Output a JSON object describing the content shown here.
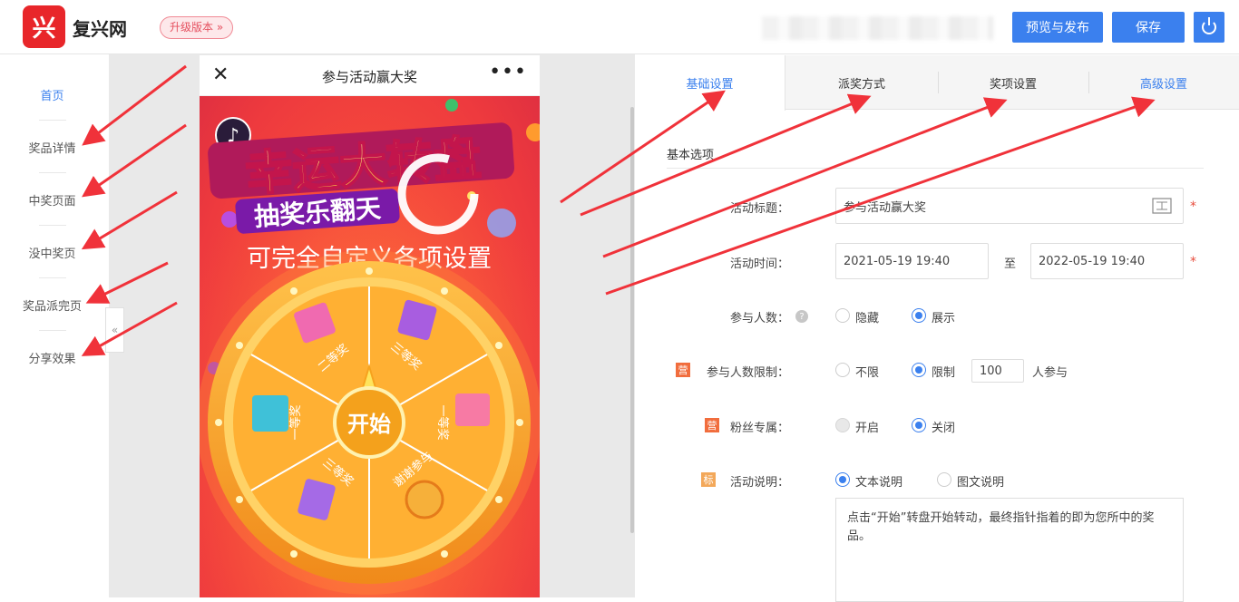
{
  "header": {
    "logo_glyph": "兴",
    "brand": "复兴网",
    "upgrade_label": "升级版本 »",
    "preview_label": "预览与发布",
    "save_label": "保存"
  },
  "sidebar": {
    "items": [
      {
        "label": "首页",
        "active": true
      },
      {
        "label": "奖品详情",
        "active": false
      },
      {
        "label": "中奖页面",
        "active": false
      },
      {
        "label": "没中奖页",
        "active": false
      },
      {
        "label": "奖品派完页",
        "active": false
      },
      {
        "label": "分享效果",
        "active": false
      }
    ],
    "collapse_glyph": "«"
  },
  "phone": {
    "title": "参与活动赢大奖",
    "close_glyph": "✕",
    "more_glyph": "•••",
    "banner_main": "幸运大转盘",
    "banner_sub": "抽奖乐翻天",
    "caption": "可完全自定义各项设置",
    "start_label": "开始",
    "wheel_prizes": [
      "二等奖",
      "三等奖",
      "一等奖",
      "一等奖",
      "谢谢参与",
      "三等奖"
    ]
  },
  "tabs": [
    {
      "label": "基础设置",
      "active": true
    },
    {
      "label": "派奖方式",
      "active": false
    },
    {
      "label": "奖项设置",
      "active": false
    },
    {
      "label": "高级设置",
      "active": false
    }
  ],
  "form": {
    "section_title": "基本选项",
    "title_label": "活动标题：",
    "title_value": "参与活动赢大奖",
    "time_label": "活动时间：",
    "time_start": "2021-05-19 19:40",
    "time_to": "至",
    "time_end": "2022-05-19 19:40",
    "count_label": "参与人数：",
    "count_hide": "隐藏",
    "count_show": "展示",
    "limit_tag": "营",
    "limit_label": "参与人数限制：",
    "limit_no": "不限",
    "limit_yes": "限制",
    "limit_value": "100",
    "limit_suffix": "人参与",
    "fans_tag": "营",
    "fans_label": "粉丝专属：",
    "fans_on": "开启",
    "fans_off": "关闭",
    "desc_tag": "标",
    "desc_label": "活动说明：",
    "desc_text_opt": "文本说明",
    "desc_image_opt": "图文说明",
    "desc_text": "点击“开始”转盘开始转动，最终指针指着的即为您所中的奖品。"
  },
  "colors": {
    "accent": "#3b80ee",
    "brand_red": "#e8262a",
    "arrow": "#f0323a"
  }
}
